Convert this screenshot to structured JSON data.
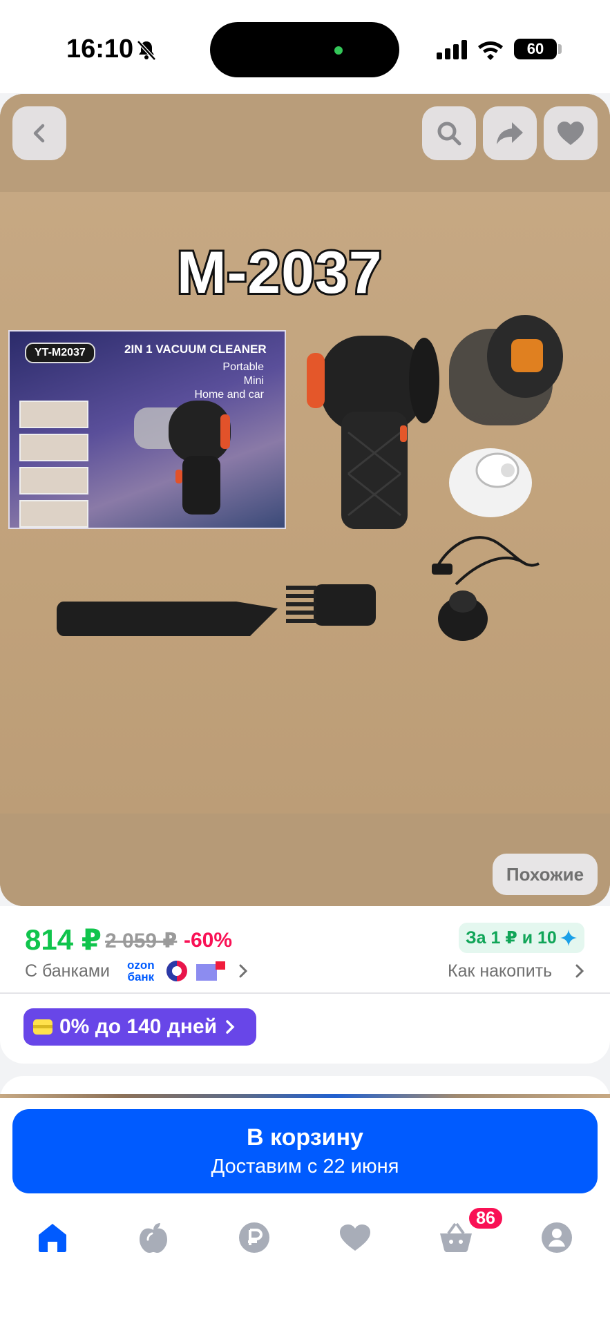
{
  "status_bar": {
    "time": "16:10",
    "battery": "60"
  },
  "product_image": {
    "model_label": "M-2037",
    "box_badge": "YT-M2037",
    "box_title": "2IN 1 VACUUM CLEANER",
    "box_lines": [
      "Portable",
      "Mini",
      "Home and car"
    ]
  },
  "image_actions": {
    "back": "back",
    "search": "search",
    "share": "share",
    "favorite": "favorite",
    "similar_label": "Похожие"
  },
  "price": {
    "current": "814 ₽",
    "old": "2 059 ₽",
    "discount": "-60%",
    "bonus": "За 1 ₽ и 10",
    "banks_label": "С банками",
    "ozon_bank_line1": "ozon",
    "ozon_bank_line2": "банк",
    "how_to_earn": "Как накопить",
    "installment": "0% до 140 дней"
  },
  "cart": {
    "title": "В корзину",
    "subtitle": "Доставим с 22 июня"
  },
  "tab_bar": {
    "items": [
      "home",
      "fresh",
      "finance",
      "favorites",
      "cart",
      "profile"
    ],
    "cart_count": "86"
  },
  "colors": {
    "accent": "#005bff",
    "price_green": "#10c44c",
    "discount_pink": "#f91155",
    "installment_purple": "#6846e8"
  }
}
